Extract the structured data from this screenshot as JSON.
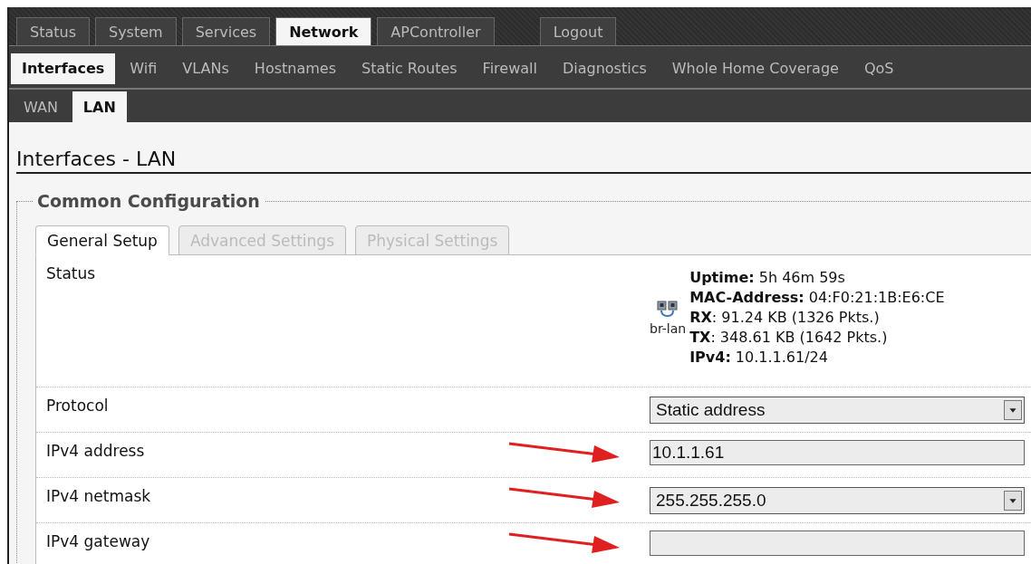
{
  "main_tabs": [
    {
      "label": "Status",
      "selected": false
    },
    {
      "label": "System",
      "selected": false
    },
    {
      "label": "Services",
      "selected": false
    },
    {
      "label": "Network",
      "selected": true
    },
    {
      "label": "APController",
      "selected": false
    },
    {
      "label": "Logout",
      "selected": false
    }
  ],
  "sub_tabs": [
    {
      "label": "Interfaces",
      "selected": true
    },
    {
      "label": "Wifi",
      "selected": false
    },
    {
      "label": "VLANs",
      "selected": false
    },
    {
      "label": "Hostnames",
      "selected": false
    },
    {
      "label": "Static Routes",
      "selected": false
    },
    {
      "label": "Firewall",
      "selected": false
    },
    {
      "label": "Diagnostics",
      "selected": false
    },
    {
      "label": "Whole Home Coverage",
      "selected": false
    },
    {
      "label": "QoS",
      "selected": false
    }
  ],
  "interface_tabs": [
    {
      "label": "WAN",
      "selected": false
    },
    {
      "label": "LAN",
      "selected": true
    }
  ],
  "heading": "Interfaces - LAN",
  "section": {
    "legend": "Common Configuration",
    "tabs": [
      {
        "label": "General Setup",
        "selected": true
      },
      {
        "label": "Advanced Settings",
        "selected": false
      },
      {
        "label": "Physical Settings",
        "selected": false
      }
    ],
    "status": {
      "label": "Status",
      "device": "br-lan",
      "lines": [
        "**Uptime:** 5h 46m 59s",
        "**MAC-Address:** 04:F0:21:1B:E6:CE",
        "**RX**: 91.24 KB (1326 Pkts.)",
        "**TX**: 348.61 KB (1642 Pkts.)",
        "**IPv4:** 10.1.1.61/24"
      ]
    },
    "fields": [
      {
        "label": "Protocol",
        "kind": "select",
        "value": "Static address",
        "arrow": false
      },
      {
        "label": "IPv4 address",
        "kind": "text",
        "value": "10.1.1.61",
        "arrow": true
      },
      {
        "label": "IPv4 netmask",
        "kind": "select",
        "value": "255.255.255.0",
        "arrow": true
      },
      {
        "label": "IPv4 gateway",
        "kind": "text",
        "arrow": true
      }
    ]
  }
}
